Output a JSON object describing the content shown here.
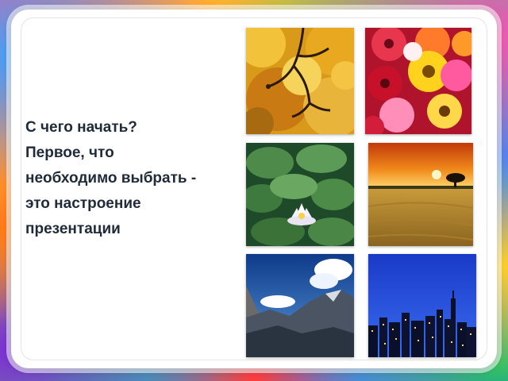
{
  "slide": {
    "text_lines": [
      "С чего начать?",
      "Первое, что",
      "необходимо выбрать -",
      "это настроение",
      "презентации"
    ]
  },
  "photos": [
    {
      "name": "autumn-tree-photo"
    },
    {
      "name": "gerbera-flowers-photo"
    },
    {
      "name": "water-lily-photo"
    },
    {
      "name": "sunset-field-photo"
    },
    {
      "name": "mountains-photo"
    },
    {
      "name": "night-city-photo"
    }
  ]
}
